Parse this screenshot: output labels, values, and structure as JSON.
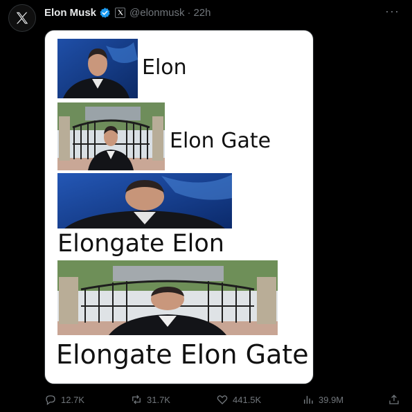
{
  "tweet": {
    "author_name": "Elon Musk",
    "handle": "@elonmusk",
    "separator": "·",
    "time": "22h",
    "verified_icon": "verified-badge-icon",
    "affiliation_icon": "x-affiliation-icon",
    "more_icon": "more-options-icon"
  },
  "media": {
    "panels": [
      {
        "caption": "Elon",
        "photo": "elon-portrait"
      },
      {
        "caption": "Elon Gate",
        "photo": "elon-at-gate"
      },
      {
        "caption": "Elongate Elon",
        "photo": "elon-stretched-portrait"
      },
      {
        "caption": "Elongate Elon Gate",
        "photo": "elon-at-stretched-gate"
      }
    ]
  },
  "actions": {
    "replies": {
      "icon": "reply-icon",
      "count": "12.7K"
    },
    "reposts": {
      "icon": "repost-icon",
      "count": "31.7K"
    },
    "likes": {
      "icon": "like-icon",
      "count": "441.5K"
    },
    "views": {
      "icon": "views-icon",
      "count": "39.9M"
    },
    "share": {
      "icon": "share-icon"
    }
  },
  "colors": {
    "background": "#000000",
    "primary_text": "#e7e9ea",
    "secondary_text": "#71767b",
    "verified_blue": "#1d9bf0"
  }
}
